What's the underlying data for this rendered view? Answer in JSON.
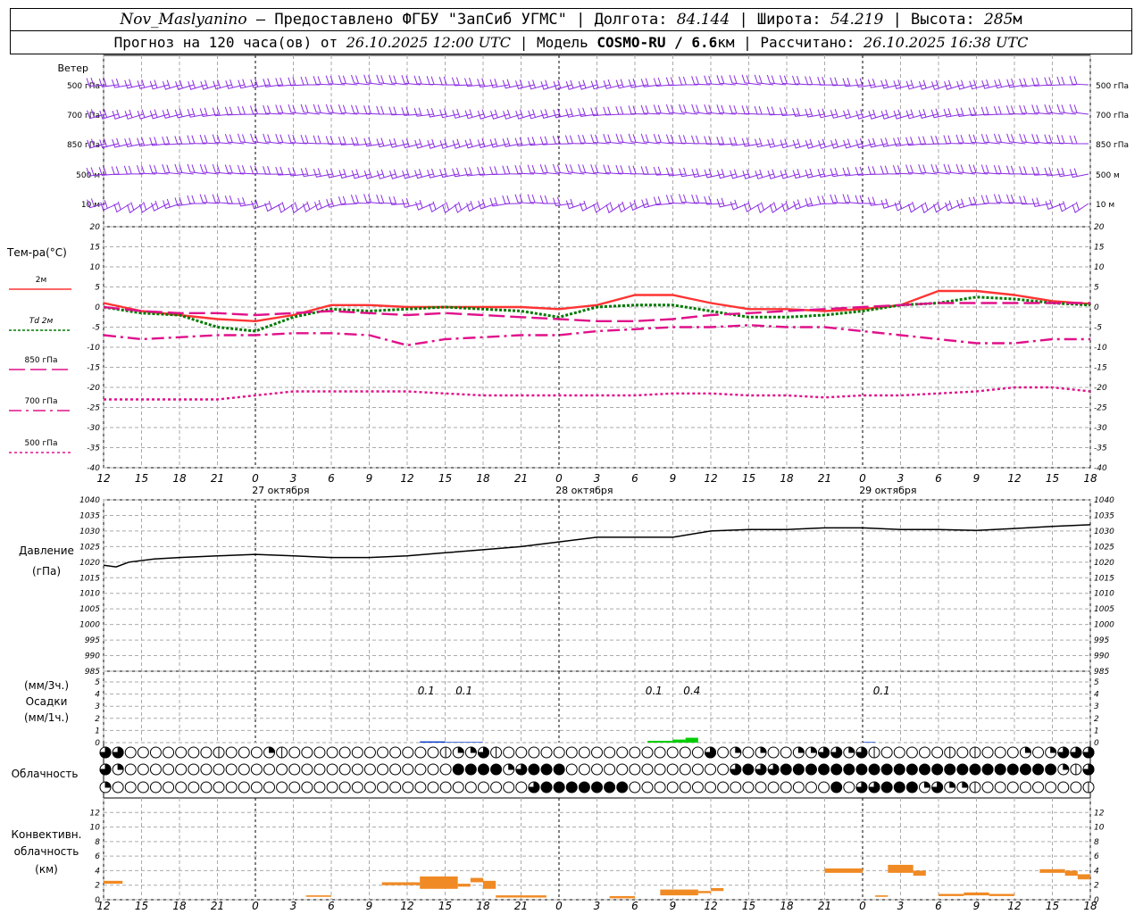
{
  "header": {
    "station": "Nov_Maslyanino",
    "provider": "Предоставлено ФГБУ \"ЗапСиб УГМС\"",
    "lon_label": "Долгота:",
    "lon": "84.144",
    "lat_label": "Широта:",
    "lat": "54.219",
    "alt_label": "Высота:",
    "alt": "285",
    "alt_unit": "м",
    "forecast_prefix": "Прогноз на 120 часа(ов) от",
    "forecast_start": "26.10.2025 12:00 UTC",
    "model_label": "Модель",
    "model": "COSMO-RU / 6.6",
    "model_unit": "км",
    "calc_label": "Рассчитано:",
    "calc_time": "26.10.2025 16:38 UTC"
  },
  "wind_panel": {
    "title": "Ветер",
    "levels": [
      "500 гПа",
      "700 гПа",
      "850 гПа",
      "500 м",
      "10 м"
    ],
    "color": "#8a2be2"
  },
  "time_axis": {
    "hours": [
      "12",
      "15",
      "18",
      "21",
      "0",
      "3",
      "6",
      "9",
      "12",
      "15",
      "18",
      "21",
      "0",
      "3",
      "6",
      "9",
      "12",
      "15",
      "18",
      "21",
      "0",
      "3",
      "6",
      "9",
      "12",
      "15",
      "18"
    ],
    "dates": [
      "27 октября",
      "28 октября",
      "29 октября"
    ]
  },
  "chart_data": [
    {
      "type": "line",
      "id": "temperature",
      "title": "Тем-ра(°C)",
      "ylim": [
        -40,
        20
      ],
      "yticks": [
        "20",
        "15",
        "10",
        "5",
        "0",
        "-5",
        "-10",
        "-15",
        "-20",
        "-25",
        "-30",
        "-35",
        "-40"
      ],
      "x": [
        0,
        3,
        6,
        9,
        12,
        15,
        18,
        21,
        24,
        27,
        30,
        33,
        36,
        39,
        42,
        45,
        48,
        51,
        54,
        57,
        60,
        63,
        66,
        69,
        72,
        75,
        78
      ],
      "series": [
        {
          "name": "2м",
          "color": "#ff3333",
          "dash": "",
          "width": 2.4,
          "values": [
            1,
            -1,
            -2,
            -3,
            -3.5,
            -2,
            0.5,
            0.5,
            0,
            0,
            0,
            0,
            -0.5,
            0.5,
            3,
            3,
            1,
            -0.5,
            -0.5,
            -1,
            -0.5,
            0.5,
            4,
            4,
            3,
            1.5,
            0.8
          ]
        },
        {
          "name": "Td 2м",
          "color": "#007a00",
          "dash": "3,2",
          "width": 3,
          "values": [
            0,
            -1.5,
            -2,
            -5,
            -6,
            -2.5,
            -0.5,
            -1,
            -0.5,
            0,
            -0.5,
            -1,
            -2.5,
            0,
            0.5,
            0.5,
            -1,
            -2.5,
            -2.5,
            -2,
            -1,
            0.5,
            1,
            2.5,
            2,
            1,
            0.5
          ]
        },
        {
          "name": "850 гПа",
          "color": "#e0108a",
          "dash": "18,6",
          "width": 2.4,
          "values": [
            0,
            -1,
            -1.5,
            -1.5,
            -2,
            -1.5,
            -1,
            -1.5,
            -2,
            -1.5,
            -2,
            -2.5,
            -3,
            -3.5,
            -3.5,
            -3,
            -2,
            -1.5,
            -1,
            -0.5,
            0,
            0.5,
            1,
            1,
            1,
            1,
            1
          ]
        },
        {
          "name": "700 гПа",
          "color": "#e0108a",
          "dash": "14,5,3,5",
          "width": 2.4,
          "values": [
            -7,
            -8,
            -7.5,
            -7,
            -7,
            -6.5,
            -6.5,
            -7,
            -9.5,
            -8,
            -7.5,
            -7,
            -7,
            -6,
            -5.5,
            -5,
            -5,
            -4.5,
            -5,
            -5,
            -6,
            -7,
            -8,
            -9,
            -9,
            -8,
            -8
          ]
        },
        {
          "name": "500 гПа",
          "color": "#e0108a",
          "dash": "3,3",
          "width": 2.4,
          "values": [
            -23,
            -23,
            -23,
            -23,
            -22,
            -21,
            -21,
            -21,
            -21,
            -21.5,
            -22,
            -22,
            -22,
            -22,
            -22,
            -21.5,
            -21.5,
            -22,
            -22,
            -22.5,
            -22,
            -22,
            -21.5,
            -21,
            -20,
            -20,
            -21
          ]
        }
      ]
    },
    {
      "type": "line",
      "id": "pressure",
      "title": "Давление",
      "unit": "(гПа)",
      "ylim": [
        985,
        1040
      ],
      "yticks": [
        "1040",
        "1035",
        "1030",
        "1025",
        "1020",
        "1015",
        "1010",
        "1005",
        "1000",
        "995",
        "990",
        "985"
      ],
      "x": [
        0,
        1,
        2,
        4,
        6,
        9,
        12,
        15,
        18,
        21,
        24,
        27,
        30,
        33,
        36,
        39,
        42,
        45,
        48,
        51,
        54,
        57,
        60,
        63,
        66,
        69,
        72,
        75,
        78
      ],
      "series": [
        {
          "name": "",
          "color": "#000000",
          "values": [
            1019,
            1018.5,
            1020,
            1021,
            1021.5,
            1022,
            1022.5,
            1022,
            1021.5,
            1021.5,
            1022,
            1023,
            1024,
            1025,
            1026.5,
            1028,
            1028,
            1028,
            1030,
            1030.5,
            1030.5,
            1031,
            1031,
            1030.5,
            1030.5,
            1030.2,
            1030.8,
            1031.5,
            1032
          ]
        }
      ]
    },
    {
      "type": "bar",
      "id": "precipitation",
      "title": "Осадки",
      "unit_top": "(мм/3ч.)",
      "unit_bottom": "(мм/1ч.)",
      "ylim": [
        0,
        5
      ],
      "yticks": [
        "5",
        "4",
        "3",
        "2",
        "1",
        "0"
      ],
      "bars": [
        {
          "start": 25,
          "end": 27,
          "value": 0.1,
          "color": "#0033cc"
        },
        {
          "start": 27,
          "end": 30,
          "value": 0.05,
          "color": "#0033cc"
        },
        {
          "start": 43,
          "end": 45,
          "value": 0.15,
          "color": "#00cc00"
        },
        {
          "start": 45,
          "end": 46,
          "value": 0.25,
          "color": "#00cc00"
        },
        {
          "start": 46,
          "end": 47,
          "value": 0.4,
          "color": "#00cc00"
        },
        {
          "start": 60,
          "end": 61,
          "value": 0.05,
          "color": "#0033cc"
        }
      ],
      "labels": [
        {
          "x": 25.5,
          "text": "0.1"
        },
        {
          "x": 28.5,
          "text": "0.1"
        },
        {
          "x": 43.5,
          "text": "0.1"
        },
        {
          "x": 46.5,
          "text": "0.4"
        },
        {
          "x": 61.5,
          "text": "0.1"
        }
      ]
    },
    {
      "type": "bar",
      "id": "convective_clouds",
      "title": "Конвективн.",
      "title2": "облачность",
      "unit": "(км)",
      "ylim": [
        0,
        14
      ],
      "yticks": [
        "12",
        "10",
        "8",
        "6",
        "4",
        "2",
        "0"
      ],
      "bars": [
        {
          "start": 0,
          "end": 1.5,
          "bottom": 2.2,
          "top": 2.6
        },
        {
          "start": 16,
          "end": 18,
          "bottom": 0.4,
          "top": 0.6
        },
        {
          "start": 22,
          "end": 25,
          "bottom": 2,
          "top": 2.4
        },
        {
          "start": 25,
          "end": 28,
          "bottom": 1.5,
          "top": 3.2
        },
        {
          "start": 28,
          "end": 29,
          "bottom": 1.8,
          "top": 2.2
        },
        {
          "start": 29,
          "end": 30,
          "bottom": 2.4,
          "top": 3
        },
        {
          "start": 30,
          "end": 31,
          "bottom": 1.5,
          "top": 2.6
        },
        {
          "start": 31,
          "end": 35,
          "bottom": 0.3,
          "top": 0.6
        },
        {
          "start": 40,
          "end": 42,
          "bottom": 0.2,
          "top": 0.5
        },
        {
          "start": 44,
          "end": 47,
          "bottom": 0.6,
          "top": 1.4
        },
        {
          "start": 47,
          "end": 48,
          "bottom": 0.9,
          "top": 1.2
        },
        {
          "start": 48,
          "end": 49,
          "bottom": 1.2,
          "top": 1.6
        },
        {
          "start": 57,
          "end": 60,
          "bottom": 3.7,
          "top": 4.3
        },
        {
          "start": 61,
          "end": 62,
          "bottom": 0.4,
          "top": 0.6
        },
        {
          "start": 62,
          "end": 64,
          "bottom": 3.7,
          "top": 4.8
        },
        {
          "start": 64,
          "end": 65,
          "bottom": 3.3,
          "top": 4
        },
        {
          "start": 66,
          "end": 68,
          "bottom": 0.5,
          "top": 0.8
        },
        {
          "start": 68,
          "end": 70,
          "bottom": 0.6,
          "top": 1
        },
        {
          "start": 70,
          "end": 72,
          "bottom": 0.5,
          "top": 0.8
        },
        {
          "start": 74,
          "end": 76,
          "bottom": 3.7,
          "top": 4.2
        },
        {
          "start": 76,
          "end": 77,
          "bottom": 3.3,
          "top": 4
        },
        {
          "start": 77,
          "end": 78,
          "bottom": 2.8,
          "top": 3.5
        }
      ],
      "color": "#f08a24"
    }
  ],
  "cloudiness": {
    "title": "Облачность",
    "rows": [
      [
        3,
        3,
        0,
        0,
        0,
        0,
        0,
        0,
        0,
        1,
        0,
        0,
        0,
        2,
        1,
        0,
        0,
        0,
        0,
        0,
        0,
        0,
        0,
        0,
        0,
        0,
        0,
        1,
        2,
        2,
        3,
        1,
        0,
        0,
        0,
        0,
        0,
        0,
        0,
        0,
        0,
        0,
        0,
        0,
        0,
        0,
        0,
        0,
        3,
        0,
        2,
        0,
        2,
        0,
        0,
        2,
        2,
        3,
        3,
        2,
        3,
        1,
        0,
        0,
        0,
        0,
        0,
        1,
        0,
        1,
        0,
        0,
        0,
        2,
        0,
        2,
        3,
        3,
        3
      ],
      [
        3,
        2,
        0,
        0,
        0,
        0,
        0,
        0,
        0,
        0,
        0,
        0,
        0,
        0,
        0,
        0,
        0,
        0,
        0,
        0,
        0,
        0,
        0,
        0,
        0,
        0,
        0,
        0,
        4,
        4,
        4,
        4,
        2,
        3,
        4,
        4,
        4,
        0,
        0,
        0,
        0,
        0,
        0,
        0,
        0,
        0,
        0,
        0,
        0,
        0,
        3,
        4,
        3,
        3,
        4,
        4,
        4,
        4,
        4,
        4,
        4,
        4,
        4,
        4,
        4,
        4,
        4,
        4,
        4,
        4,
        4,
        4,
        4,
        4,
        4,
        4,
        2,
        1,
        3
      ],
      [
        2,
        0,
        0,
        0,
        0,
        0,
        0,
        0,
        0,
        0,
        0,
        0,
        0,
        0,
        0,
        0,
        0,
        0,
        0,
        0,
        0,
        0,
        0,
        0,
        0,
        0,
        0,
        0,
        0,
        0,
        0,
        0,
        0,
        0,
        3,
        4,
        4,
        4,
        4,
        4,
        4,
        4,
        0,
        0,
        0,
        0,
        0,
        0,
        0,
        0,
        0,
        0,
        0,
        0,
        0,
        0,
        0,
        0,
        4,
        0,
        3,
        3,
        4,
        4,
        4,
        2,
        3,
        2,
        2,
        1,
        0,
        0,
        0,
        0,
        0,
        0,
        0,
        0,
        1
      ]
    ]
  }
}
